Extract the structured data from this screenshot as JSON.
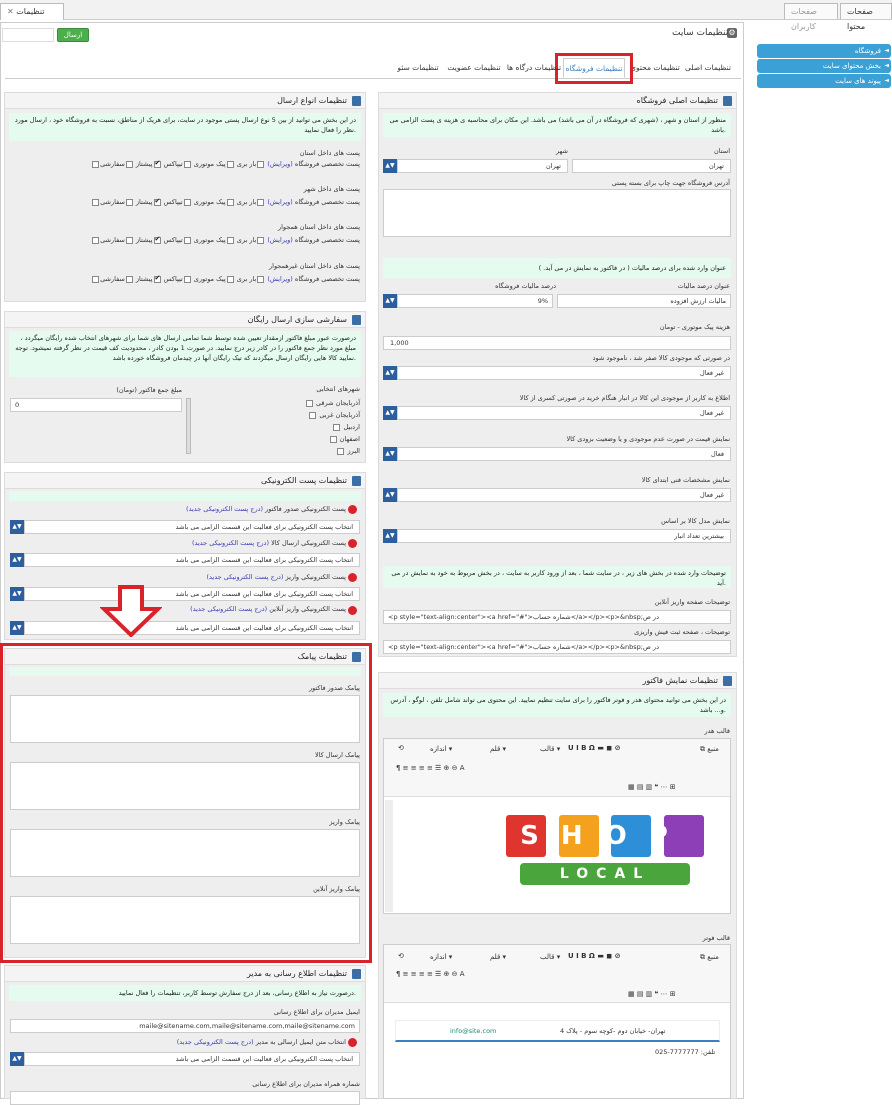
{
  "top_tabs": [
    {
      "label": "صفحات محتوا"
    },
    {
      "label": "صفحات کاربران"
    },
    {
      "label": "تنظیمات سایت"
    }
  ],
  "send_button": "ارسال",
  "page_title": "تنظیمات سایت",
  "right_nav": [
    {
      "label": "فروشگاه"
    },
    {
      "label": "بخش محتوای سایت"
    },
    {
      "label": "پیوند های سایت"
    }
  ],
  "settings_tabs": [
    {
      "label": "تنظیمات اصلی"
    },
    {
      "label": "تنظیمات محتوی"
    },
    {
      "label": "تنظیمات فروشگاه"
    },
    {
      "label": "تنظیمات درگاه ها"
    },
    {
      "label": "تنظیمات عضویت"
    },
    {
      "label": "تنظیمات سئو"
    }
  ],
  "store": {
    "title": "تنظیمات اصلی فروشگاه",
    "info": "منظور از استان و شهر ، (شهری که فروشگاه در آن می باشد) می باشد. این مکان برای محاسبه ی هزینه ی پست الزامی می باشد.",
    "province_label": "استان",
    "province_value": "تهران",
    "city_label": "شهر",
    "city_value": "تهران",
    "address_label": "آدرس فروشگاه جهت چاپ برای بسته پستی",
    "tax_info": "عنوان وارد شده برای درصد مالیات ( در فاکتور به نمایش در می آید. )",
    "tax_title_label": "عنوان درصد مالیات",
    "tax_title_value": "مالیات ارزش افزوده",
    "tax_pct_label": "درصد مالیات فروشگاه",
    "tax_pct_value": "9%",
    "courier_label": "هزینه پیک موتوری - تومان",
    "courier_value": "1,000",
    "zero_stock_label": "در صورتی که موجودی کالا صفر شد ، ناموجود شود",
    "zero_stock_value": "غیر فعال",
    "notify_label": "اطلاع به کاربر از موجودی این کالا در انبار هنگام خرید در صورتی کسری از کالا",
    "notify_value": "غیر فعال",
    "show_price_label": "نمایش قیمت در صورت عدم موجودی و یا وضعیت بزودی کالا",
    "show_price_value": "فعال",
    "show_specs_label": "نمایش مشخصات فنی ابتدای کالا",
    "show_specs_value": "غیر فعال",
    "sort_label": "نمایش مدل کالا بر اساس",
    "sort_value": "بیشترین تعداد انبار",
    "desc_info": "توضیحات وارد شده در بخش های زیر ، در سایت شما ، بعد از ورود کاربر به سایت ، در بخش مربوط به خود به نمایش در می آید.",
    "online_pay_label": "توضیحات صفحه واریز آنلاین",
    "online_pay_value": "<p style=\"text-align:center\"><a href=\"#\">شماره حساب</a></p><p>&nbsp;در ص",
    "receipt_label": "توضیحات ، صفحه ثبت فیش واریزی",
    "receipt_value": "<p style=\"text-align:center\"><a href=\"#\">شماره حساب</a></p><p>&nbsp;در ص"
  },
  "shipping": {
    "title": "تنظیمات انواع ارسال",
    "info": "در این بخش می توانید از بین 5 نوع ارسال پستی موجود در سایت، برای هریک از مناطق، نسبت به فروشگاه خود ، ارسال مورد نظر را فعال نمایید.",
    "opt_custom": "سفارشی",
    "opt_pishtaz": "پیشتاز",
    "opt_tipax": "تیپاکس",
    "opt_motor": "پیک موتوری",
    "opt_cargo": "بار بری",
    "opt_special": "پست تخصصی فروشگاه",
    "edit": "(ویرایش)",
    "groups": [
      {
        "label": "پست های داخل استان"
      },
      {
        "label": "پست های داخل شهر"
      },
      {
        "label": "پست های داخل استان همجوار"
      },
      {
        "label": "پست های داخل استان غیرهمجوار"
      }
    ]
  },
  "free": {
    "title": "سفارشی سازی ارسال رایگان",
    "info": "درصورت عبور مبلغ فاکتور ازمقدار تعیین شده توسط شما تمامی ارسال های شما برای شهرهای انتخاب شده رایگان میگردد ، مبلغ مورد نظر جمع فاکتور را در کادر زیر درج نمایید. در صورت 1 بودن کادر ، محدودیت کف قیمت در نظر گرفته نمیشود. توجه نمایید کالا هایی رایگان ارسال میگردند که تیک رایگان آنها در چیدمان فروشگاه خورده باشد.",
    "min_label": "مبلغ جمع فاکتور (تومان)",
    "min_value": "0",
    "cities_label": "شهرهای انتخابی",
    "cities": [
      {
        "label": "آذربایجان شرقی"
      },
      {
        "label": "آذربایجان غربی"
      },
      {
        "label": "اردبیل"
      },
      {
        "label": "اصفهان"
      },
      {
        "label": "البرز"
      }
    ]
  },
  "email": {
    "title": "تنظیمات پست الکترونیکی",
    "select_placeholder": "انتخاب پست الکترونیکی برای فعالیت این قسمت الزامی می باشد",
    "new_link": "(درج پست الکترونیکی جدید)",
    "items": [
      {
        "label": "پست الکترونیکی صدور فاکتور"
      },
      {
        "label": "پست الکترونیکی ارسال کالا"
      },
      {
        "label": "پست الکترونیکی واریز"
      },
      {
        "label": "پست الکترونیکی واریز آنلاین"
      }
    ]
  },
  "sms": {
    "title": "تنظیمات پیامک",
    "items": [
      {
        "label": "پیامک صدور فاکتور"
      },
      {
        "label": "پیامک ارسال کالا"
      },
      {
        "label": "پیامک واریز"
      },
      {
        "label": "پیامک واریز آنلاین"
      }
    ]
  },
  "admin": {
    "title": "تنظیمات اطلاع رسانی به مدیر",
    "info": "درصورت نیاز به اطلاع رسانی، بعد از درج سفارش توسط کاربر، تنظیمات را فعال نمایید.",
    "emails_label": "ایمیل مدیران برای اطلاع رسانی",
    "emails_value": "maile@sitename.com,maile@sitename.com,maile@sitename.com",
    "choose_email": "انتخاب متن ایمیل ارسالی به مدیر",
    "phones_label": "شماره همراه مدیران برای اطلاع رسانی"
  },
  "invoice": {
    "title": "تنظیمات نمایش فاکتور",
    "info": "در این بخش می توانید محتوای هدر و فوتر فاکتور را برای سایت تنظیم نمایید. این محتوی می تواند شامل تلفن ، لوگو ، آدرس و... باشد.",
    "header_label": "قالب هدر",
    "footer_label": "قالب فوتر",
    "tb_source": "منبع",
    "tb_format": "قالب",
    "tb_font": "قلم",
    "tb_size": "اندازه",
    "logo_top": "SHOP",
    "logo_bottom": "LOCAL",
    "footer_address": "تهران- خیابان دوم -کوچه سوم - پلاک 4",
    "footer_email": "info@site.com",
    "footer_phone": "تلفن: 7777777-025"
  }
}
